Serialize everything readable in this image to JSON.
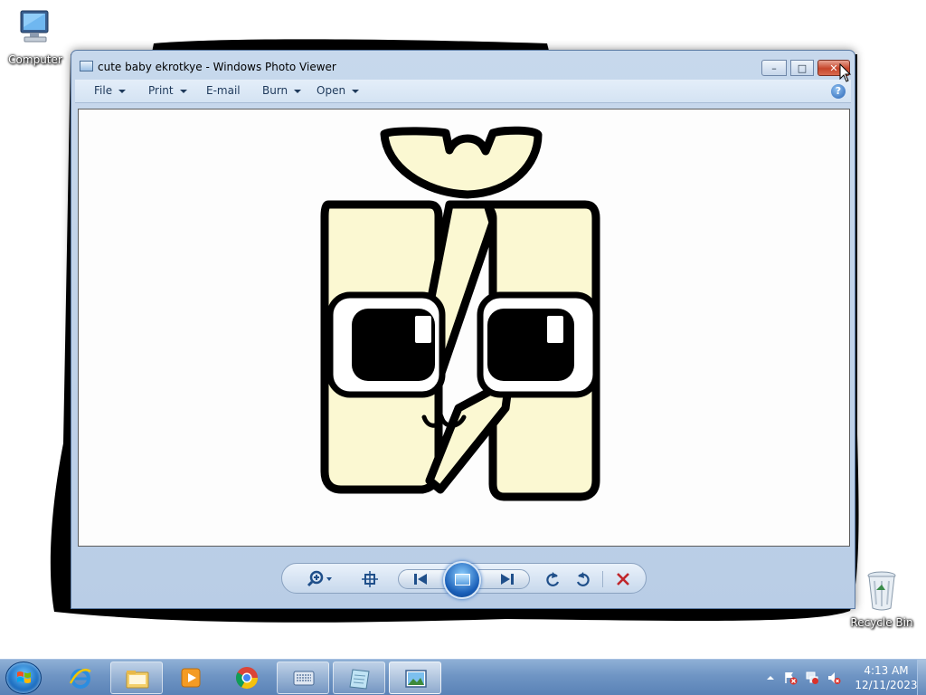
{
  "desktop": {
    "icons": [
      {
        "label": "Computer",
        "icon": "computer-icon"
      },
      {
        "label": "Recycle Bin",
        "icon": "recycle-bin-icon"
      }
    ]
  },
  "window": {
    "title": "cute baby ekrotkye - Windows Photo Viewer",
    "caption_buttons": {
      "minimize": "–",
      "maximize": "□",
      "close": "✕"
    },
    "menu": [
      {
        "label": "File",
        "has_dropdown": true
      },
      {
        "label": "Print",
        "has_dropdown": true
      },
      {
        "label": "E-mail",
        "has_dropdown": false
      },
      {
        "label": "Burn",
        "has_dropdown": true
      },
      {
        "label": "Open",
        "has_dropdown": true
      }
    ],
    "help_label": "?",
    "toolbar": {
      "zoom": "zoom-icon",
      "fit": "actual-size-icon",
      "previous": "previous-icon",
      "slideshow": "slideshow-icon",
      "next": "next-icon",
      "rotate_ccw": "rotate-counterclockwise-icon",
      "rotate_cw": "rotate-clockwise-icon",
      "delete": "delete-icon"
    },
    "image_fill_color": "#fbf8d2",
    "image_outline_color": "#000000"
  },
  "taskbar": {
    "items": [
      {
        "name": "internet-explorer-icon",
        "state": "pinned"
      },
      {
        "name": "windows-explorer-icon",
        "state": "open"
      },
      {
        "name": "media-player-icon",
        "state": "pinned"
      },
      {
        "name": "chrome-icon",
        "state": "pinned"
      },
      {
        "name": "on-screen-keyboard-icon",
        "state": "open"
      },
      {
        "name": "notepad-icon",
        "state": "open"
      },
      {
        "name": "photo-viewer-icon",
        "state": "active"
      }
    ],
    "tray": {
      "icons": [
        "show-hidden-icons-chevron",
        "action-center-icon",
        "network-icon",
        "volume-muted-icon"
      ],
      "time": "4:13 AM",
      "date": "12/11/2023"
    }
  },
  "colors": {
    "taskbar": "#6f95c4",
    "window_frame": "#c7d8ec",
    "close_button": "#c6452a"
  }
}
